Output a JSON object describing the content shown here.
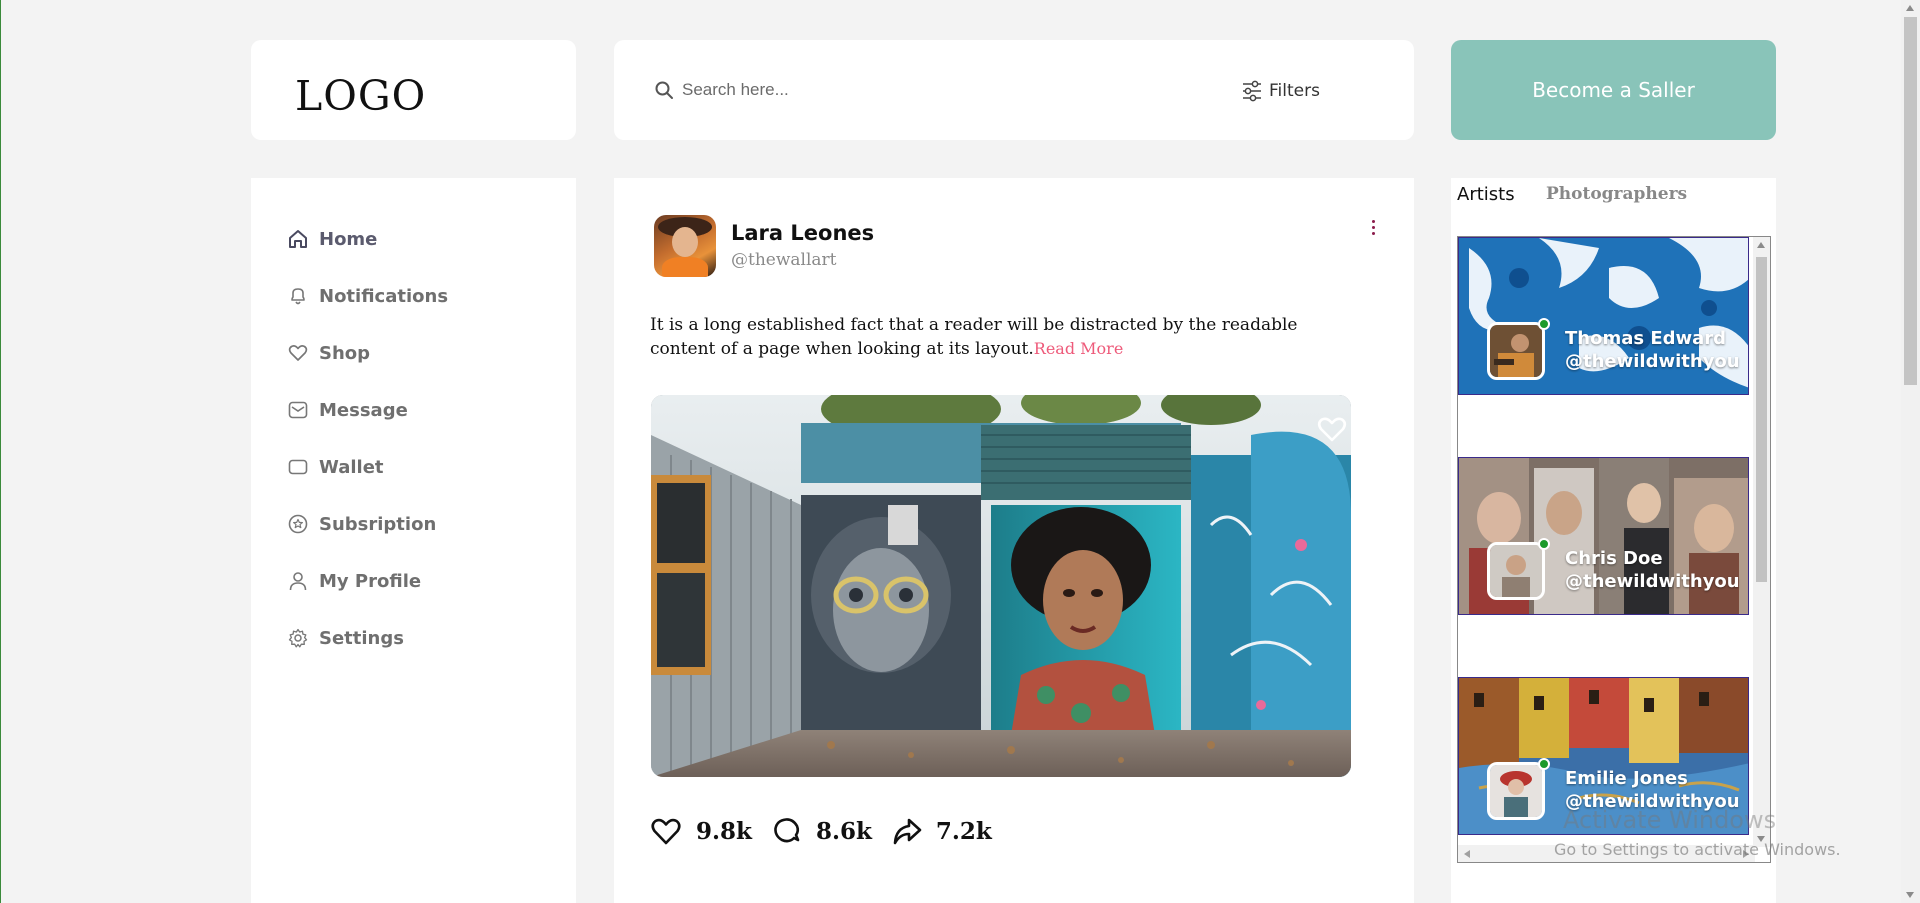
{
  "header": {
    "logo": "LOGO",
    "search_placeholder": "Search here...",
    "filters_label": "Filters",
    "seller_button": "Become a Saller",
    "accent_color": "#89c4b9"
  },
  "sidebar": {
    "items": [
      {
        "label": "Home",
        "icon": "home-icon",
        "active": true
      },
      {
        "label": "Notifications",
        "icon": "bell-icon"
      },
      {
        "label": "Shop",
        "icon": "heart-icon"
      },
      {
        "label": "Message",
        "icon": "mail-icon"
      },
      {
        "label": "Wallet",
        "icon": "wallet-icon"
      },
      {
        "label": "Subsription",
        "icon": "star-badge-icon"
      },
      {
        "label": "My Profile",
        "icon": "user-icon"
      },
      {
        "label": "Settings",
        "icon": "gear-icon"
      }
    ]
  },
  "post": {
    "author_name": "Lara Leones",
    "author_handle": "@thewallart",
    "text": "It is a long established fact that a reader will be distracted by the readable content of a page when looking at its layout.",
    "read_more": "Read More",
    "likes": "9.8k",
    "comments": "8.6k",
    "shares": "7.2k",
    "read_more_color": "#ee5a7a"
  },
  "right_panel": {
    "tabs": [
      "Artists",
      "Photographers"
    ],
    "active_tab": "Artists",
    "artists": [
      {
        "name": "Thomas Edward",
        "handle": "@thewildwithyou"
      },
      {
        "name": "Chris Doe",
        "handle": "@thewildwithyou"
      },
      {
        "name": "Emilie Jones",
        "handle": "@thewildwithyou"
      }
    ],
    "online_color": "#1c9a2a"
  },
  "watermark": {
    "line1": "Activate Windows",
    "line2": "Go to Settings to activate Windows."
  }
}
